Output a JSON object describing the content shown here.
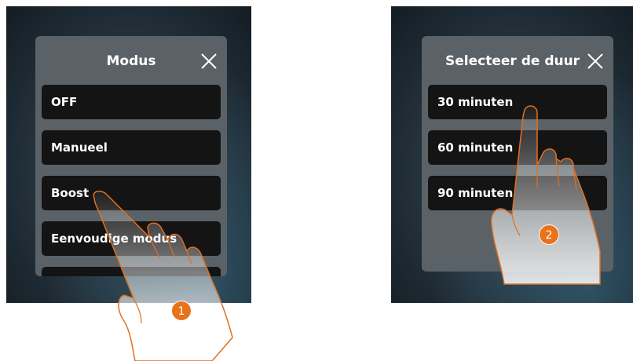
{
  "left_panel": {
    "title": "Modus",
    "close_icon": "close-icon",
    "options": [
      "OFF",
      "Manueel",
      "Boost",
      "Eenvoudige modus"
    ]
  },
  "right_panel": {
    "title": "Selecteer de duur",
    "close_icon": "close-icon",
    "options": [
      "30 minuten",
      "60 minuten",
      "90 minuten"
    ]
  },
  "steps": {
    "step1": "1",
    "step2": "2"
  },
  "colors": {
    "badge": "#e8731a",
    "panel": "#5b6267",
    "option_bg": "#141414"
  }
}
